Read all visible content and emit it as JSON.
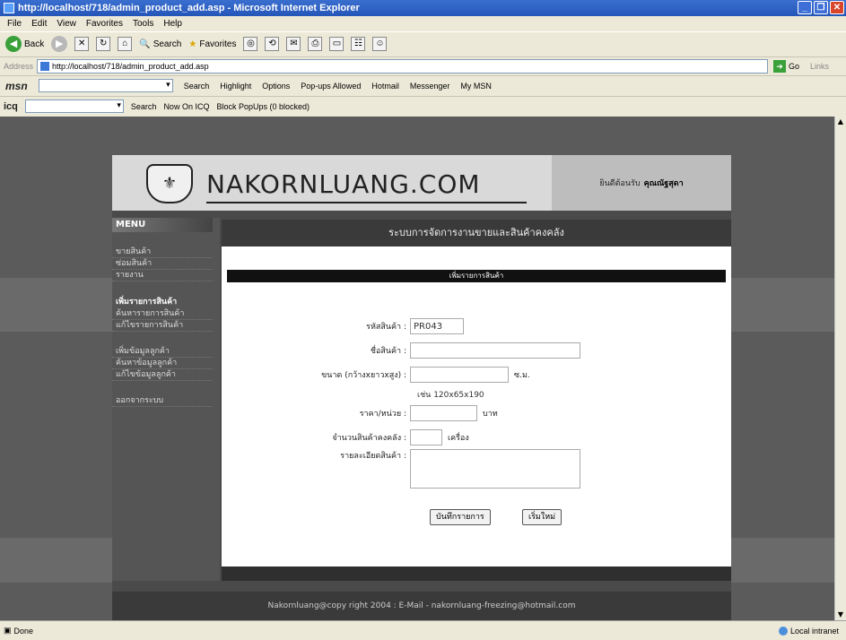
{
  "window": {
    "title": "http://localhost/718/admin_product_add.asp - Microsoft Internet Explorer"
  },
  "menubar": [
    "File",
    "Edit",
    "View",
    "Favorites",
    "Tools",
    "Help"
  ],
  "toolbar": {
    "back": "Back",
    "search": "Search",
    "favorites": "Favorites"
  },
  "address": {
    "label": "Address",
    "url": "http://localhost/718/admin_product_add.asp",
    "go": "Go",
    "links": "Links"
  },
  "msn": {
    "logo": "msn",
    "search": "Search",
    "highlight": "Highlight",
    "options": "Options",
    "popups": "Pop-ups Allowed",
    "hotmail": "Hotmail",
    "messenger": "Messenger",
    "mymsn": "My MSN"
  },
  "icq": {
    "logo": "icq",
    "search": "Search",
    "now_on": "Now On ICQ",
    "block": "Block PopUps (0 blocked)"
  },
  "site": {
    "brand": "NAKORNLUANG.COM",
    "welcome_text": "ยินดีต้อนรับ",
    "welcome_user": "คุณณัฐสุดา",
    "menu_title": "MENU",
    "menu_items_a": [
      "ขายสินค้า",
      "ซ่อมสินค้า",
      "รายงาน"
    ],
    "menu_head": "เพิ่มรายการสินค้า",
    "menu_items_b": [
      "ค้นหารายการสินค้า",
      "แก้ไขรายการสินค้า"
    ],
    "menu_items_c": [
      "เพิ่มข้อมูลลูกค้า",
      "ค้นหาข้อมูลลูกค้า",
      "แก้ไขข้อมูลลูกค้า"
    ],
    "logout": "ออกจากระบบ",
    "main_title": "ระบบการจัดการงานขายและสินค้าคงคลัง",
    "sub_title": "เพิ่มรายการสินค้า",
    "form": {
      "code_label": "รหัสสินค้า :",
      "code_value": "PR043",
      "name_label": "ชื่อสินค้า :",
      "size_label": "ขนาด (กว้างxยาวxสูง) :",
      "size_unit": "ซ.ม.",
      "size_hint": "เช่น 120x65x190",
      "price_label": "ราคา/หน่วย :",
      "price_unit": "บาท",
      "stock_label": "จำนวนสินค้าคงคลัง :",
      "stock_unit": "เครื่อง",
      "detail_label": "รายละเอียดสินค้า :",
      "save_button": "บันทึกรายการ",
      "reset_button": "เริ่มใหม่"
    },
    "footer": "Nakornluang@copy right 2004 : E-Mail - nakornluang-freezing@hotmail.com"
  },
  "status": {
    "left": "Done",
    "right": "Local intranet"
  }
}
